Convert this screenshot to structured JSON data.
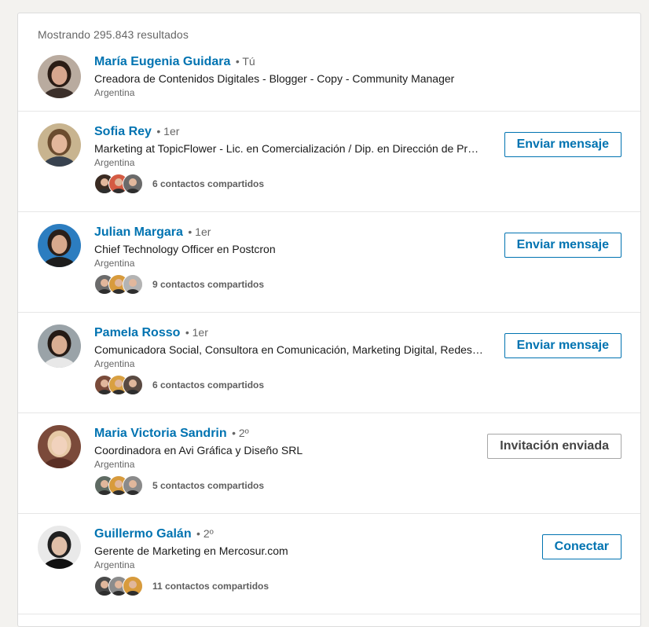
{
  "results_count": "Mostrando 295.843 resultados",
  "people": [
    {
      "name": "María Eugenia Guidara",
      "degree": "• Tú",
      "headline": "Creadora de Contenidos Digitales - Blogger - Copy - Community Manager",
      "location": "Argentina",
      "avatar_colors": {
        "bg": "#b9ab9f",
        "hair": "#2a1c15",
        "skin": "#d7a68e",
        "shirt": "#3b2f2a"
      }
    },
    {
      "name": "Sofia Rey",
      "degree": "• 1er",
      "headline": "Marketing at TopicFlower - Lic. en Comercialización / Dip. en Dirección de Producto",
      "location": "Argentina",
      "shared": "6 contactos compartidos",
      "action": "Enviar mensaje",
      "avatar_colors": {
        "bg": "#c8b48f",
        "hair": "#6b4c2f",
        "skin": "#e3b79b",
        "shirt": "#38424f"
      },
      "facepile": [
        "#3a2b22",
        "#d45b43",
        "#6a6a6a"
      ]
    },
    {
      "name": "Julian Margara",
      "degree": "• 1er",
      "headline": "Chief Technology Officer en Postcron",
      "location": "Argentina",
      "shared": "9 contactos compartidos",
      "action": "Enviar mensaje",
      "avatar_colors": {
        "bg": "#2c7dc0",
        "hair": "#2a1f1a",
        "skin": "#d8a98d",
        "shirt": "#1d1d1d"
      },
      "facepile": [
        "#6b6b6b",
        "#d89b3c",
        "#b3b3b3"
      ]
    },
    {
      "name": "Pamela Rosso",
      "degree": "• 1er",
      "headline": "Comunicadora Social, Consultora en Comunicación, Marketing Digital, Redes Sociales",
      "location": "Argentina",
      "shared": "6 contactos compartidos",
      "action": "Enviar mensaje",
      "avatar_colors": {
        "bg": "#9aa3a8",
        "hair": "#241a15",
        "skin": "#d9ae93",
        "shirt": "#e8e8e8"
      },
      "facepile": [
        "#7a4b3a",
        "#d9a041",
        "#5a4a42"
      ]
    },
    {
      "name": "Maria Victoria Sandrin",
      "degree": "• 2º",
      "headline": "Coordinadora en Avi Gráfica y Diseño SRL",
      "location": "Argentina",
      "shared": "5 contactos compartidos",
      "action": "Invitación enviada",
      "action_muted": true,
      "avatar_colors": {
        "bg": "#7b4a3a",
        "hair": "#e6c9a6",
        "skin": "#f1d2bd",
        "shirt": "#5a2f25"
      },
      "facepile": [
        "#5f6b63",
        "#d89b3c",
        "#8a8a8a"
      ]
    },
    {
      "name": "Guillermo Galán",
      "degree": "• 2º",
      "headline": "Gerente de Marketing en Mercosur.com",
      "location": "Argentina",
      "shared": "11 contactos compartidos",
      "action": "Conectar",
      "avatar_colors": {
        "bg": "#e9e9e9",
        "hair": "#202020",
        "skin": "#e0bfa8",
        "shirt": "#111111"
      },
      "facepile": [
        "#4a4a4a",
        "#8c8c8c",
        "#d89b3c"
      ]
    }
  ]
}
